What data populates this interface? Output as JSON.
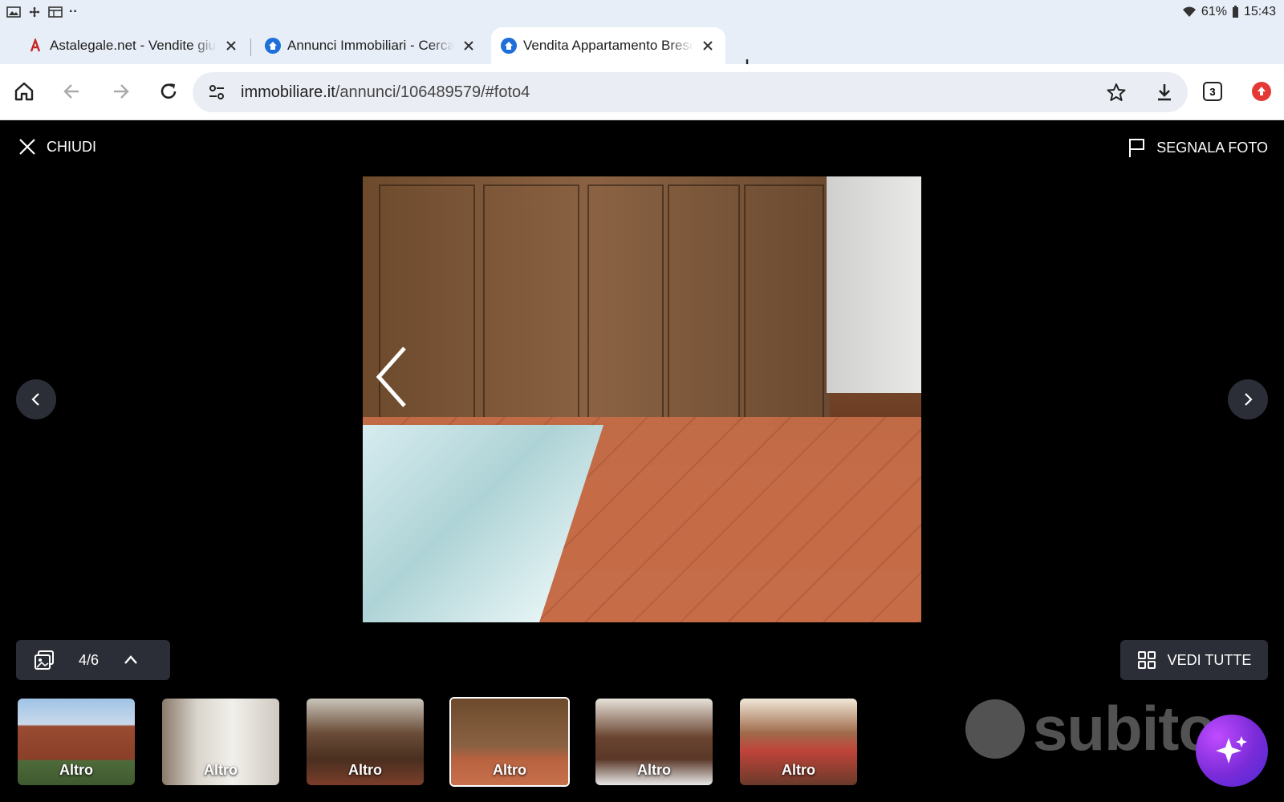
{
  "statusbar": {
    "battery": "61%",
    "time": "15:43"
  },
  "tabs": [
    {
      "title": "Astalegale.net - Vendite giudiziarie",
      "favicon": "astalegale-icon",
      "active": false
    },
    {
      "title": "Annunci Immobiliari - Cerca",
      "favicon": "immobiliare-icon",
      "active": false
    },
    {
      "title": "Vendita Appartamento Brescia",
      "favicon": "immobiliare-icon",
      "active": true
    }
  ],
  "toolbar": {
    "url_domain": "immobiliare.it",
    "url_path": "/annunci/106489579/#foto4",
    "tab_count": "3"
  },
  "viewer": {
    "close_label": "CHIUDI",
    "report_label": "SEGNALA FOTO",
    "counter": "4/6",
    "view_all_label": "VEDI TUTTE",
    "watermark": "subito",
    "thumbnails": [
      {
        "label": "Altro"
      },
      {
        "label": "Altro"
      },
      {
        "label": "Altro"
      },
      {
        "label": "Altro",
        "active": true
      },
      {
        "label": "Altro"
      },
      {
        "label": "Altro"
      }
    ]
  },
  "colors": {
    "viewer_bg": "#000000",
    "control_bg": "#2b2e36",
    "accent": "#1e6fd9"
  }
}
